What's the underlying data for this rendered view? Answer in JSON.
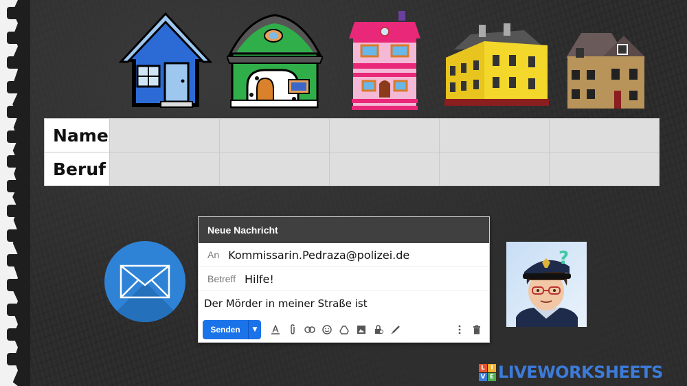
{
  "table": {
    "row_labels": [
      "Name",
      "Beruf"
    ]
  },
  "compose": {
    "title": "Neue Nachricht",
    "to_label": "An",
    "to_value": "Kommissarin.Pedraza@polizei.de",
    "subject_label": "Betreff",
    "subject_value": "Hilfe!",
    "body": "Der Mörder in meiner Straße ist",
    "send_label": "Senden"
  },
  "logo": {
    "letters": [
      "L",
      "I",
      "V",
      "E"
    ],
    "text": "LIVEWORKSHEETS"
  },
  "colors": {
    "send_button": "#1a73e8",
    "mail_circle": "#2f83d6",
    "logo_blue": "#3d7bd9"
  },
  "icons": [
    "mail-icon",
    "format-text-icon",
    "attach-icon",
    "link-icon",
    "emoji-icon",
    "drive-icon",
    "image-icon",
    "confidential-icon",
    "signature-icon",
    "more-icon",
    "trash-icon"
  ]
}
